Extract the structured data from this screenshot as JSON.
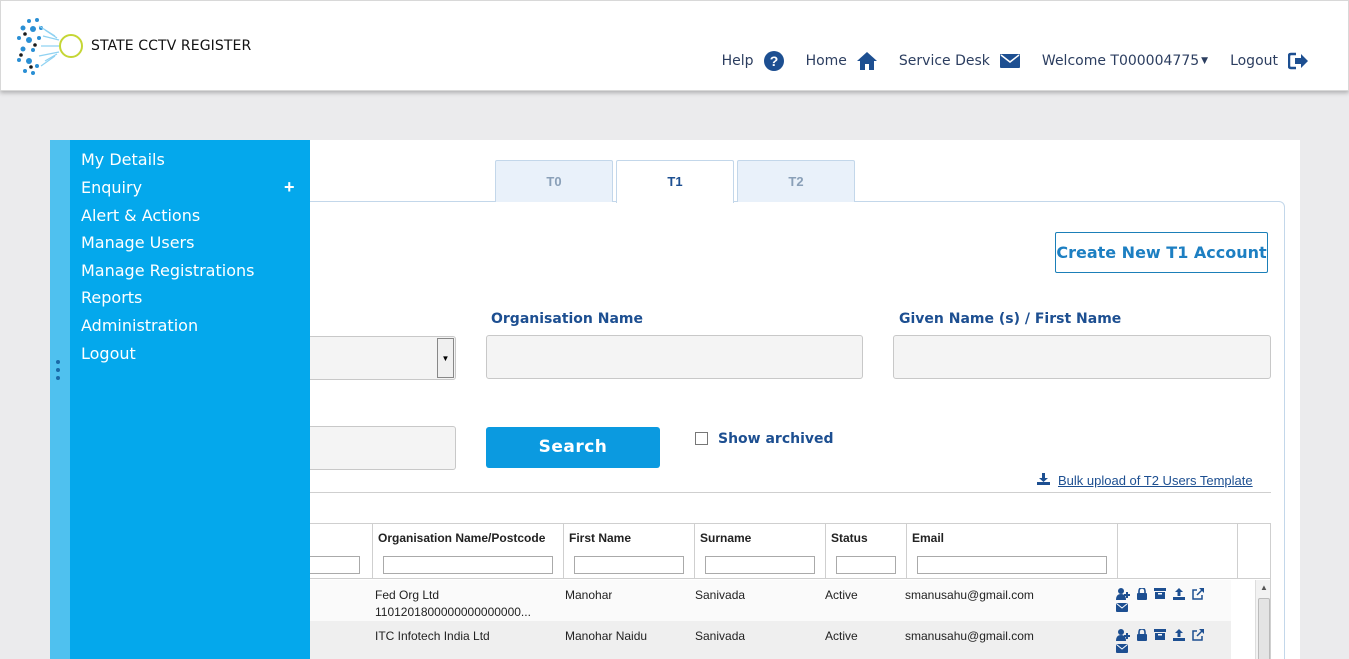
{
  "header": {
    "brand": "STATE CCTV REGISTER",
    "nav": {
      "help": "Help",
      "home": "Home",
      "service_desk": "Service Desk",
      "welcome": "Welcome T000004775",
      "logout": "Logout"
    }
  },
  "sidebar": {
    "items": [
      {
        "label": "My Details"
      },
      {
        "label": "Enquiry"
      },
      {
        "label": "Alert & Actions"
      },
      {
        "label": "Manage Users"
      },
      {
        "label": "Manage Registrations"
      },
      {
        "label": "Reports"
      },
      {
        "label": "Administration"
      },
      {
        "label": "Logout"
      }
    ],
    "expand_symbol": "+"
  },
  "tabs": [
    {
      "label": "T0",
      "active": false
    },
    {
      "label": "T1",
      "active": true
    },
    {
      "label": "T2",
      "active": false
    }
  ],
  "form": {
    "create_button": "Create New T1 Account",
    "org_name_label": "Organisation Name",
    "given_name_label": "Given Name (s) / First Name",
    "search_button": "Search",
    "show_archived_label": "Show archived",
    "bulk_upload_link": "Bulk upload of T2 Users Template"
  },
  "table": {
    "columns": [
      "Organisation Name/Postcode",
      "First Name",
      "Surname",
      "Status",
      "Email"
    ],
    "rows": [
      {
        "org": "Fed Org Ltd",
        "postcode": "1101201800000000000000...",
        "first_name": "Manohar",
        "surname": "Sanivada",
        "status": "Active",
        "email": "smanusahu@gmail.com"
      },
      {
        "org": "ITC Infotech India Ltd",
        "postcode": "",
        "first_name": "Manohar Naidu",
        "surname": "Sanivada",
        "status": "Active",
        "email": "smanusahu@gmail.com"
      }
    ]
  },
  "colors": {
    "sidebar_bg": "#04a8ec",
    "primary_button": "#0b9ae0",
    "label_text": "#1d4f91"
  }
}
